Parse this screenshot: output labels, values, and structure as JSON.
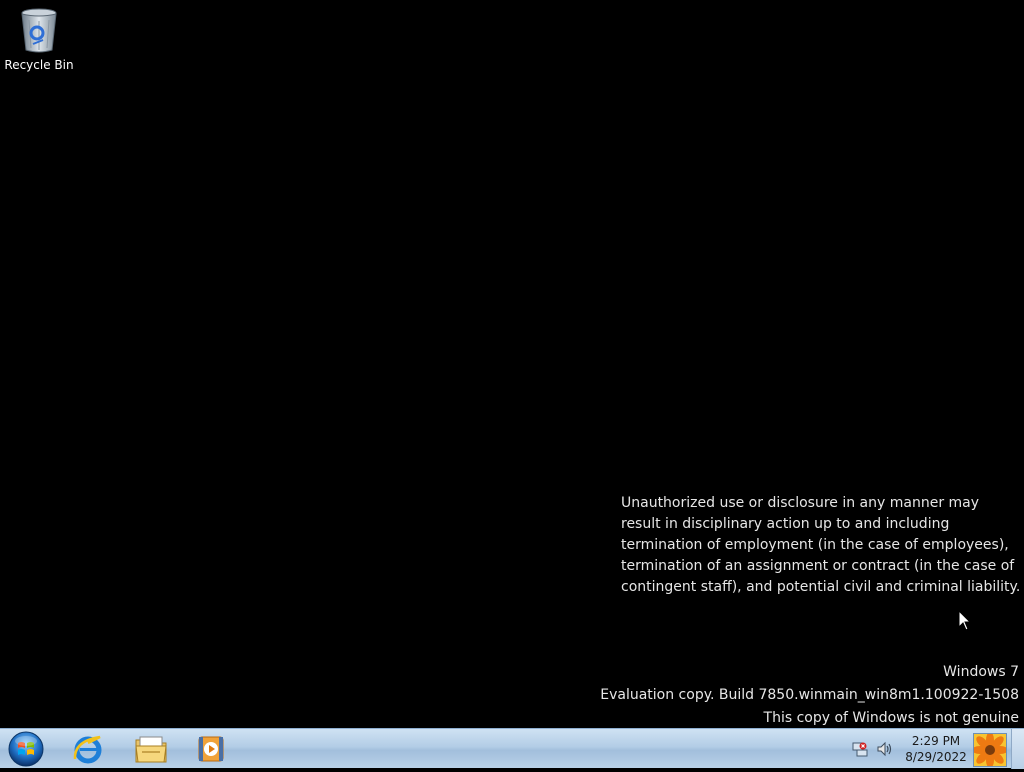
{
  "desktop": {
    "background_color": "#000000",
    "icons": [
      {
        "label": "Recycle Bin",
        "icon": "recycle-bin-icon"
      }
    ]
  },
  "notice": {
    "text": "Unauthorized use or disclosure in any manner may result in disciplinary action up to and including termination of employment (in the case of employees), termination of an assignment or contract (in the case of contingent staff), and potential civil and criminal liability."
  },
  "watermark": {
    "product": "Windows 7",
    "build": "Evaluation copy. Build 7850.winmain_win8m1.100922-1508",
    "genuine": "This copy of Windows is not genuine"
  },
  "taskbar": {
    "start_icon": "windows-start-orb-icon",
    "pinned": [
      {
        "name": "internet-explorer",
        "icon": "internet-explorer-icon"
      },
      {
        "name": "windows-explorer",
        "icon": "folder-icon"
      },
      {
        "name": "media-player",
        "icon": "media-player-icon"
      }
    ],
    "tray": {
      "network_icon": "network-error-icon",
      "volume_icon": "speaker-icon",
      "time": "2:29 PM",
      "date": "8/29/2022",
      "user_tile_icon": "flower-user-tile"
    }
  }
}
